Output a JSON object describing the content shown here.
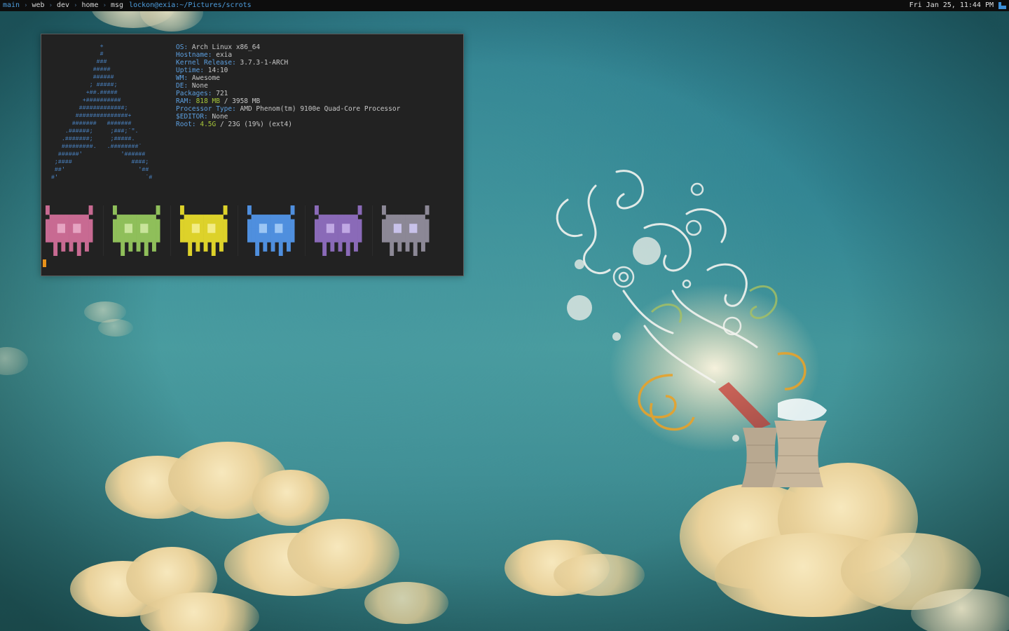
{
  "topbar": {
    "tags": [
      "main",
      "web",
      "dev",
      "home",
      "msg"
    ],
    "active_tag": "main",
    "separator_icon": "chevron-right-icon",
    "window_title": "lockon@exia:~/Pictures/scrots",
    "clock": "Fri Jan 25, 11:44 PM",
    "layout_icon": "tile-layout-icon"
  },
  "terminal": {
    "ascii_logo": "                +\n                #\n               ###\n              #####\n              ######\n             ; #####;\n            +##.#####\n           +##########\n          #############;\n         ###############+\n        #######   #######\n      .######;     ;###;`\".\n     .#######;     ;#####.\n     #########.   .########`\n    ######'           '######\n   ;####                 ####;\n   ##'                     '##\n  #'                         `#",
    "info": {
      "os_label": "OS:",
      "os": "Arch Linux x86_64",
      "hostname_label": "Hostname:",
      "hostname": "exia",
      "kernel_label": "Kernel Release:",
      "kernel": "3.7.3-1-ARCH",
      "uptime_label": "Uptime:",
      "uptime": "14:10",
      "wm_label": "WM:",
      "wm": "Awesome",
      "de_label": "DE:",
      "de": "None",
      "packages_label": "Packages:",
      "packages": "721",
      "ram_label": "RAM:",
      "ram_used": "818 MB",
      "ram_total": "/ 3958 MB",
      "processor_label": "Processor Type:",
      "processor": "AMD Phenom(tm) 9100e Quad-Core Processor",
      "editor_label": "$EDITOR:",
      "editor": "None",
      "root_label": "Root:",
      "root_used": "4.5G",
      "root_rest": "/ 23G (19%) (ext4)"
    },
    "invader_colors": [
      "#c86a92",
      "#8fbf5a",
      "#ddd22a",
      "#4f8fde",
      "#8a6ab8",
      "#8c8896"
    ],
    "invader_eye_colors": [
      "#e6a4c2",
      "#c8e49a",
      "#f2ec84",
      "#9cc6f4",
      "#c0a8e4",
      "#c8c2ea"
    ],
    "cursor_color": "#e8921a"
  },
  "wallpaper": {
    "accent_sky": "#3a8f98",
    "accent_cloud": "#f1e1b0"
  }
}
